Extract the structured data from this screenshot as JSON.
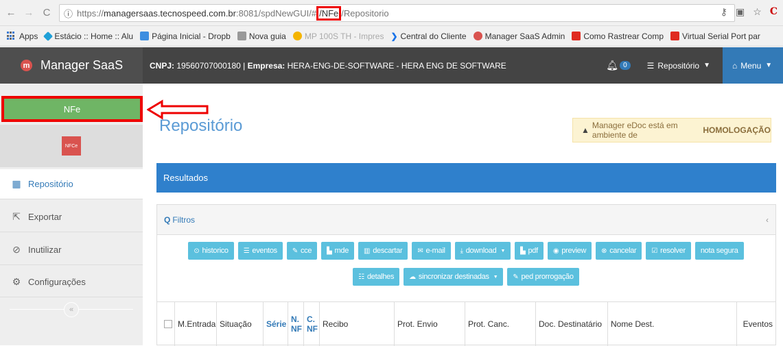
{
  "browser": {
    "url_prefix": "https://",
    "url_host": "managersaas.tecnospeed.com.br",
    "url_path": ":8081/spdNewGUI/#",
    "url_highlight": "/NFe",
    "url_suffix": "/Repositorio"
  },
  "bookmarks": [
    {
      "label": "Apps",
      "color": "#3a7bd5"
    },
    {
      "label": "Estácio :: Home :: Alu",
      "color": "#1fa0d8"
    },
    {
      "label": "Página Inicial - Dropb",
      "color": "#3d8ee0"
    },
    {
      "label": "Nova guia",
      "color": "#888888"
    },
    {
      "label": "MP 100S TH - Impres",
      "color": "#f4b400"
    },
    {
      "label": "Central do Cliente",
      "color": "#1a73e8"
    },
    {
      "label": "Manager SaaS Admin",
      "color": "#d9534f"
    },
    {
      "label": "Como Rastrear Comp",
      "color": "#e02b20"
    },
    {
      "label": "Virtual Serial Port par",
      "color": "#e02b20"
    }
  ],
  "header": {
    "brand": "Manager SaaS",
    "cnpj_label": "CNPJ:",
    "cnpj_value": "19560707000180 |",
    "empresa_label": "Empresa:",
    "empresa_value": "HERA-ENG-DE-SOFTWARE - HERA ENG DE SOFTWARE",
    "notifications": "0",
    "repo_menu": "Repositório",
    "menu": "Menu"
  },
  "sidebar": {
    "nfe": "NFe",
    "nfce": "NFCe",
    "items": [
      {
        "label": "Repositório",
        "icon": "table-icon"
      },
      {
        "label": "Exportar",
        "icon": "external-link-icon"
      },
      {
        "label": "Inutilizar",
        "icon": "ban-icon"
      },
      {
        "label": "Configurações",
        "icon": "gear-icon"
      }
    ]
  },
  "main": {
    "title": "Repositório",
    "alert_text": "Manager eDoc está em ambiente de",
    "alert_strong": "HOMOLOGAÇÃO",
    "results": "Resultados",
    "filters": "Filtros",
    "buttons_row1": [
      "historico",
      "eventos",
      "cce",
      "mde",
      "descartar",
      "e-mail",
      "download",
      "pdf",
      "preview",
      "cancelar",
      "resolver",
      "nota segura"
    ],
    "buttons_row2": [
      "detalhes",
      "sincronizar destinadas",
      "ped prorrogação"
    ],
    "columns": [
      "M.Entrada",
      "Situação",
      "Série",
      "N. NF",
      "C. NF",
      "Recibo",
      "Prot. Envio",
      "Prot. Canc.",
      "Doc. Destinatário",
      "Nome Dest.",
      "Eventos"
    ]
  }
}
